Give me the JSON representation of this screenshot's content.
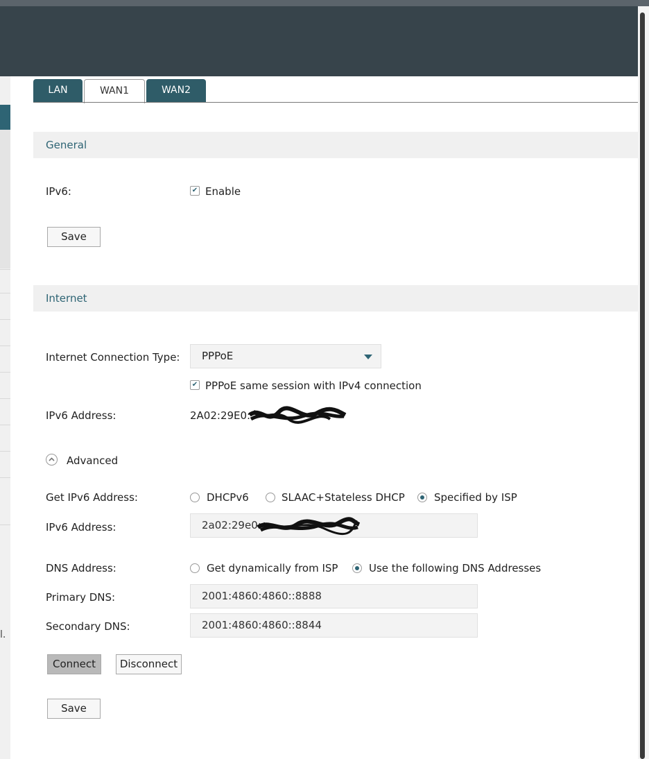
{
  "tabs": [
    "LAN",
    "WAN1",
    "WAN2"
  ],
  "active_tab": "WAN1",
  "general": {
    "title": "General",
    "ipv6_label": "IPv6:",
    "enable_label": "Enable",
    "enable_checked": true,
    "save_label": "Save"
  },
  "internet": {
    "title": "Internet",
    "conn_type_label": "Internet Connection Type:",
    "conn_type_value": "PPPoE",
    "same_session_label": "PPPoE same session with IPv4 connection",
    "same_session_checked": true,
    "ipv6_address_label": "IPv6 Address:",
    "ipv6_address_value": "2A02:29E0:",
    "advanced_label": "Advanced",
    "get_ipv6_label": "Get IPv6 Address:",
    "get_ipv6_options": [
      "DHCPv6",
      "SLAAC+Stateless DHCP",
      "Specified by ISP"
    ],
    "get_ipv6_selected": "Specified by ISP",
    "ipv6_field_label": "IPv6 Address:",
    "ipv6_field_value": "2a02:29e0:",
    "dns_label": "DNS Address:",
    "dns_options": [
      "Get dynamically from ISP",
      "Use the following DNS Addresses"
    ],
    "dns_selected": "Use the following DNS Addresses",
    "primary_dns_label": "Primary DNS:",
    "primary_dns_value": "2001:4860:4860::8888",
    "secondary_dns_label": "Secondary DNS:",
    "secondary_dns_value": "2001:4860:4860::8844",
    "connect_label": "Connect",
    "disconnect_label": "Disconnect",
    "save_label": "Save"
  },
  "left_fragment": "l.",
  "colors": {
    "accent": "#2e6474",
    "header": "#37444b"
  }
}
